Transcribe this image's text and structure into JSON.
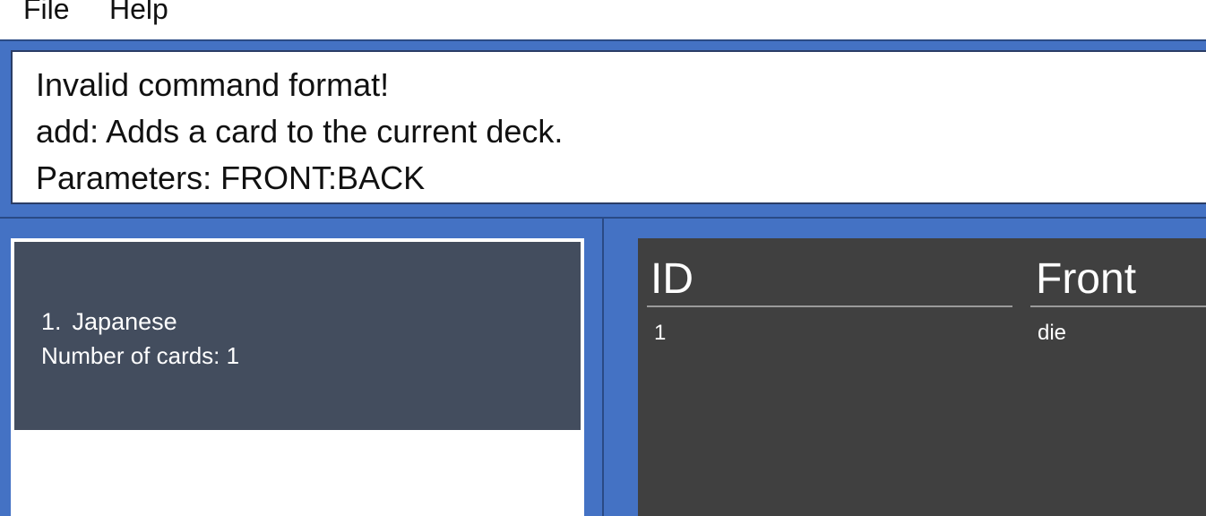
{
  "menu": {
    "file_label": "File",
    "help_label": "Help"
  },
  "result_display": {
    "lines": [
      "Invalid command format!",
      "add: Adds a card to the current deck.",
      "Parameters: FRONT:BACK"
    ]
  },
  "deck_list": {
    "items": [
      {
        "index": "1.",
        "name": "Japanese",
        "count_text": "Number of cards: 1"
      }
    ]
  },
  "card_table": {
    "columns": [
      "ID",
      "Front"
    ],
    "rows": [
      [
        "1",
        "die"
      ]
    ]
  },
  "colors": {
    "window_background": "#4472c4",
    "deck_card_background": "#434d5e",
    "table_background": "#404040"
  }
}
